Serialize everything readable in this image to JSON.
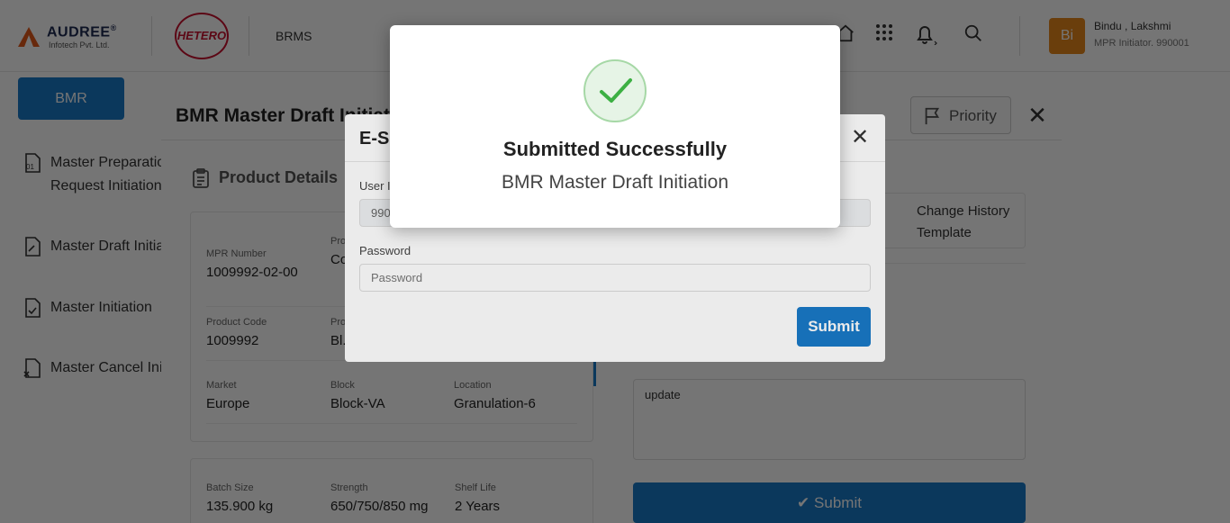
{
  "header": {
    "brand_name": "AUDREE",
    "brand_reg": "®",
    "brand_sub": "Infotech Pvt. Ltd.",
    "client_logo": "HETERO",
    "app_name": "BRMS",
    "icons": [
      "home-icon",
      "apps-grid-icon",
      "bell-icon",
      "search-icon"
    ],
    "user": {
      "initials": "Bi",
      "name": "Bindu , Lakshmi",
      "role": "MPR Initiator. 990001"
    }
  },
  "sidebar": {
    "module_button": "BMR",
    "items": [
      {
        "label": "Master Preparation Request Initiation",
        "icon": "document-01-icon"
      },
      {
        "label": "Master Draft Initiation",
        "icon": "document-edit-icon"
      },
      {
        "label": "Master Initiation",
        "icon": "document-check-icon"
      },
      {
        "label": "Master Cancel Initiation",
        "icon": "document-cancel-icon"
      }
    ]
  },
  "drawer": {
    "title": "BMR Master Draft Initiation",
    "priority_label": "Priority",
    "product_details_title": "Product Details",
    "fields": {
      "mpr_number": {
        "label": "MPR Number",
        "value": "1009992-02-00"
      },
      "product_name": {
        "label": "Product Name",
        "value": "Co... Su..."
      },
      "product_code": {
        "label": "Product Code",
        "value": "1009992"
      },
      "product_type": {
        "label": "Product Type",
        "value": "Bl..."
      },
      "market": {
        "label": "Market",
        "value": "Europe"
      },
      "block": {
        "label": "Block",
        "value": "Block-VA"
      },
      "location": {
        "label": "Location",
        "value": "Granulation-6"
      },
      "batch_size": {
        "label": "Batch Size",
        "value": "135.900 kg"
      },
      "strength": {
        "label": "Strength",
        "value": "650/750/850 mg"
      },
      "shelf_life": {
        "label": "Shelf Life",
        "value": "2 Years"
      }
    },
    "template_label": "Change History Template",
    "remarks_value": "update",
    "submit_label": "Submit"
  },
  "esignature": {
    "title": "E-Signature",
    "user_label": "User ID",
    "user_value": "990001",
    "password_label": "Password",
    "password_placeholder": "Password",
    "submit_label": "Submit"
  },
  "success": {
    "title": "Submitted Successfully",
    "subtitle": "BMR Master Draft Initiation"
  },
  "colors": {
    "primary": "#1a7ac8",
    "success_green": "#3cb043",
    "accent_orange": "#e8891c"
  }
}
